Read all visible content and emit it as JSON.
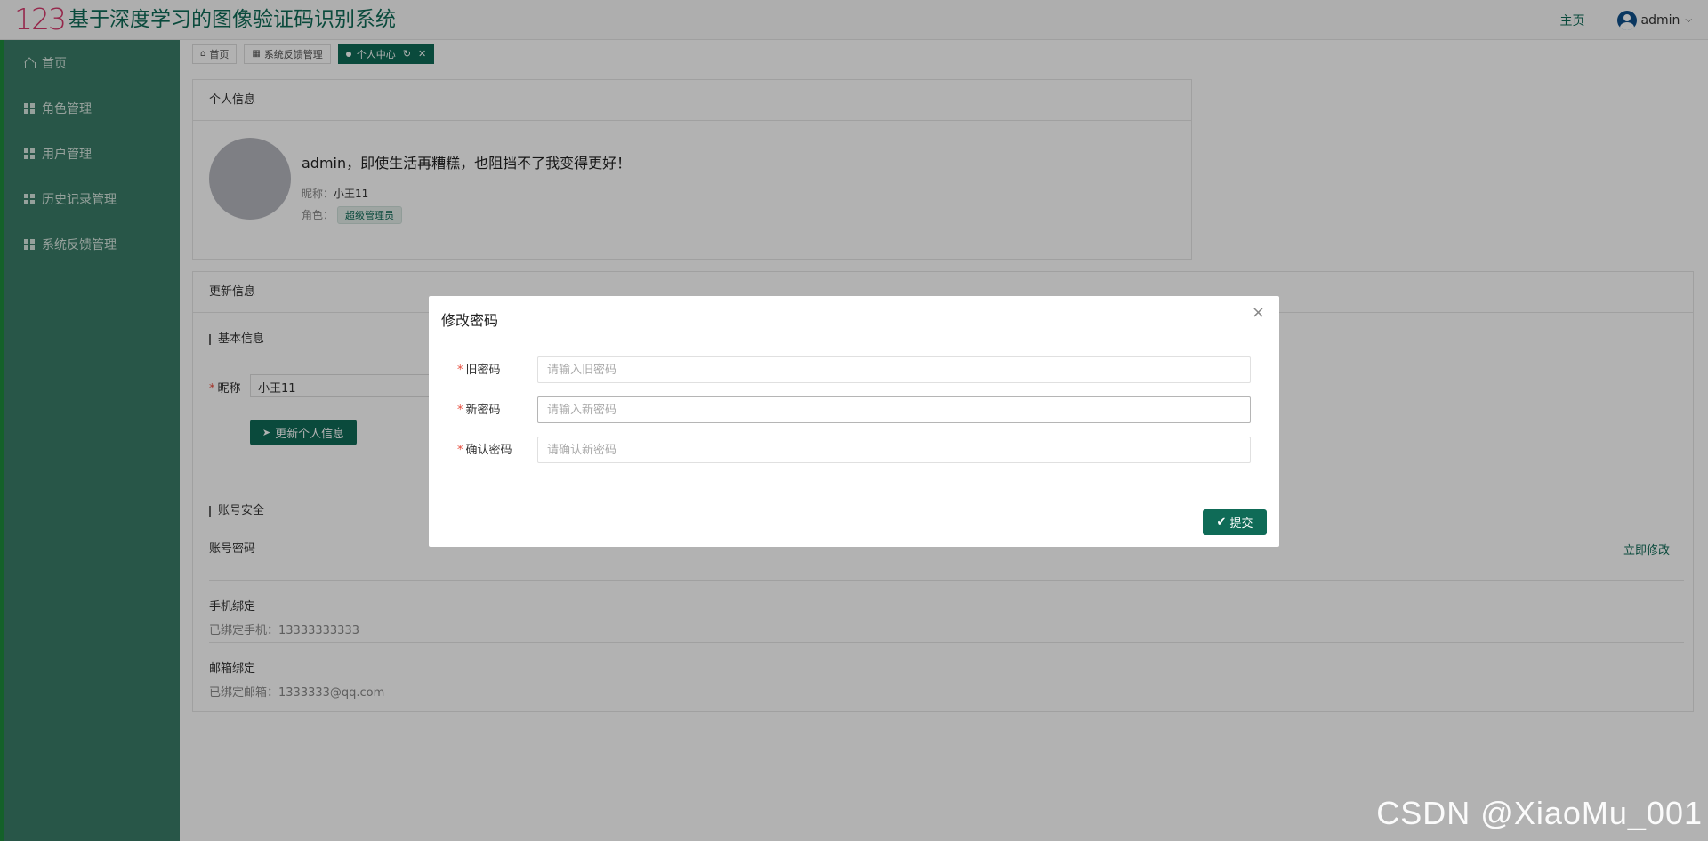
{
  "header": {
    "logo_mark": "123",
    "title": "基于深度学习的图像验证码识别系统",
    "home_link": "主页",
    "username": "admin"
  },
  "sidebar": {
    "items": [
      {
        "label": "首页",
        "icon": "home-icon"
      },
      {
        "label": "角色管理",
        "icon": "grid-icon"
      },
      {
        "label": "用户管理",
        "icon": "grid-icon"
      },
      {
        "label": "历史记录管理",
        "icon": "grid-icon"
      },
      {
        "label": "系统反馈管理",
        "icon": "grid-icon"
      }
    ]
  },
  "tabs": [
    {
      "label": "首页"
    },
    {
      "label": "系统反馈管理"
    },
    {
      "label": "个人中心"
    }
  ],
  "profile": {
    "card_title": "个人信息",
    "greeting": "admin，即使生活再糟糕，也阻挡不了我变得更好！",
    "nickname_label": "昵称：",
    "nickname": "小王11",
    "role_label": "角色：",
    "role": "超级管理员"
  },
  "update": {
    "card_title": "更新信息",
    "basic_section": "基本信息",
    "nickname_label": "昵称",
    "nickname_value": "小王11",
    "update_button": "更新个人信息",
    "security_section": "账号安全",
    "password_title": "账号密码",
    "modify_link": "立即修改",
    "phone_title": "手机绑定",
    "phone_sub": "已绑定手机：13333333333",
    "email_title": "邮箱绑定",
    "email_sub": "已绑定邮箱：1333333@qq.com"
  },
  "modal": {
    "title": "修改密码",
    "old_label": "旧密码",
    "old_placeholder": "请输入旧密码",
    "new_label": "新密码",
    "new_placeholder": "请输入新密码",
    "confirm_label": "确认密码",
    "confirm_placeholder": "请确认新密码",
    "submit": "提交"
  },
  "watermark": "CSDN @XiaoMu_001",
  "colors": {
    "primary": "#0f6b57",
    "sidebar": "#3a7c67",
    "required": "#e74c3c"
  }
}
